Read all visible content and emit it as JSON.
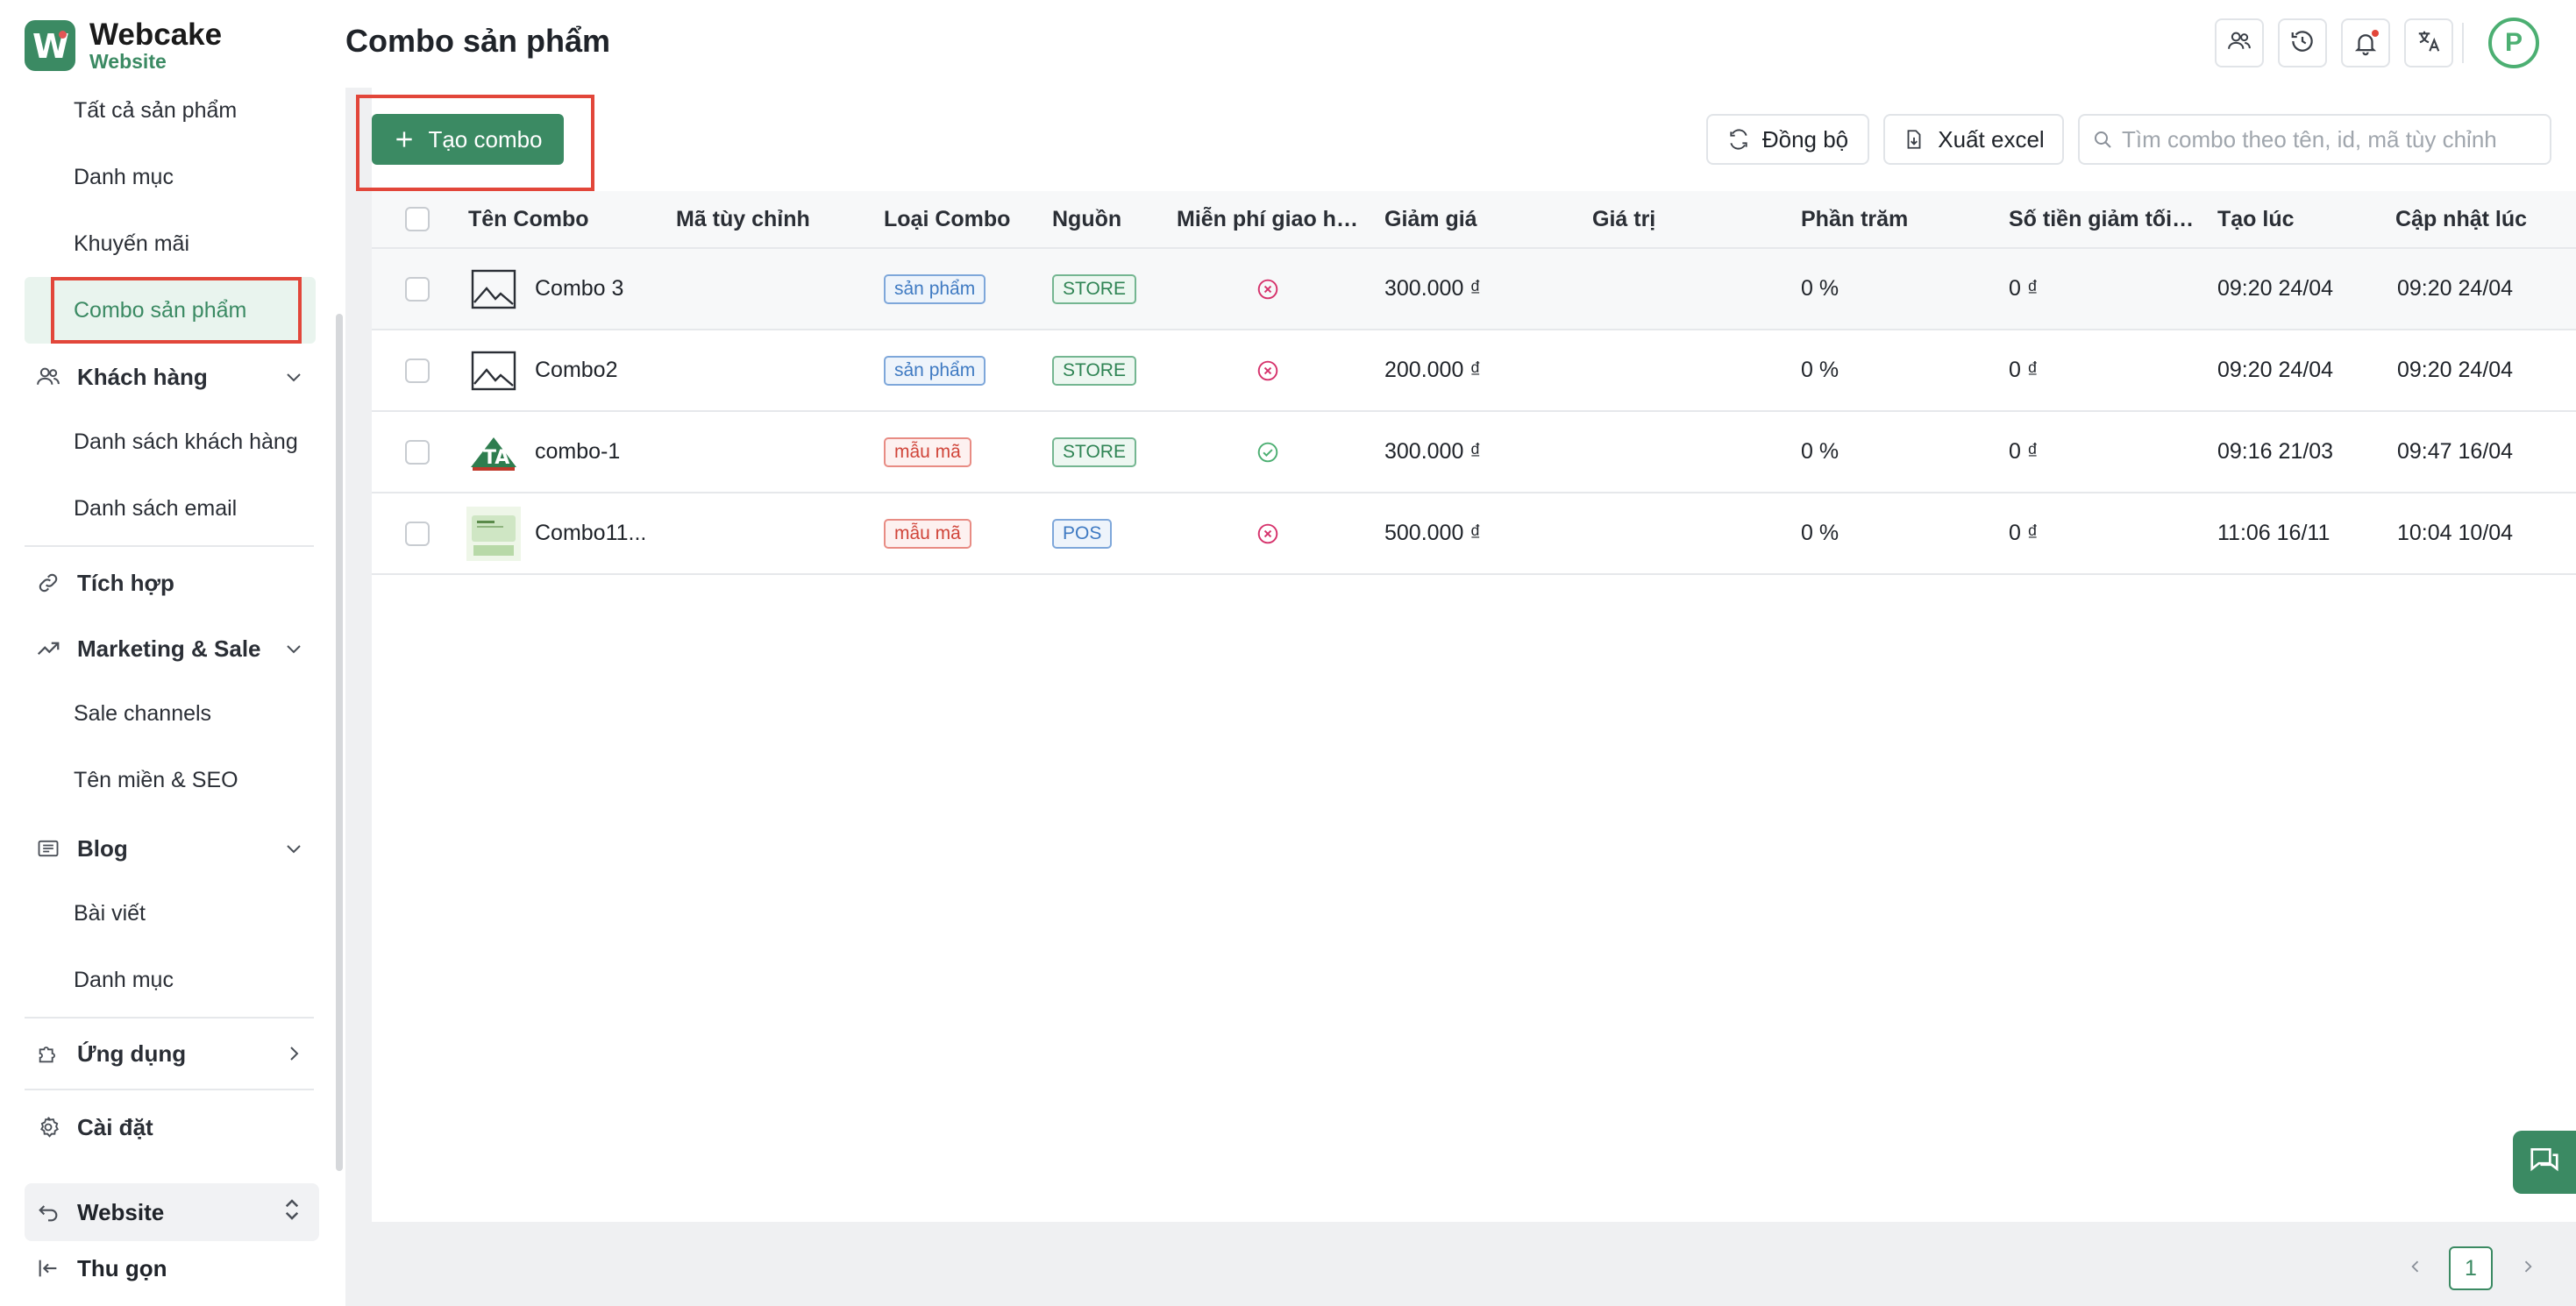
{
  "app": {
    "logo_name": "Webcake",
    "logo_sub": "Website",
    "logo_letter": "W"
  },
  "sidebar": {
    "product_items": [
      "Tất cả sản phẩm",
      "Danh mục",
      "Khuyến mãi"
    ],
    "active_item": "Combo sản phẩm",
    "customers": {
      "label": "Khách hàng",
      "items": [
        "Danh sách khách hàng",
        "Danh sách email"
      ]
    },
    "integration": "Tích hợp",
    "marketing": {
      "label": "Marketing & Sale",
      "items": [
        "Sale channels",
        "Tên miền & SEO"
      ]
    },
    "blog": {
      "label": "Blog",
      "items": [
        "Bài viết",
        "Danh mục"
      ]
    },
    "apps": "Ứng dụng",
    "settings": "Cài đặt",
    "site_switch": "Website",
    "collapse": "Thu gọn"
  },
  "header": {
    "title": "Combo sản phẩm",
    "avatar_letter": "P"
  },
  "toolbar": {
    "create_label": "Tạo combo",
    "sync_label": "Đồng bộ",
    "export_label": "Xuất excel",
    "search_placeholder": "Tìm combo theo tên, id, mã tùy chỉnh"
  },
  "table": {
    "columns": [
      "Tên Combo",
      "Mã tùy chỉnh",
      "Loại Combo",
      "Nguồn",
      "Miễn phí giao hà...",
      "Giảm giá",
      "Giá trị",
      "Phần trăm",
      "Số tiền giảm tối ...",
      "Tạo lúc",
      "Cập nhật lúc"
    ],
    "rows": [
      {
        "name": "Combo 3",
        "code": "",
        "type": "sản phẩm",
        "type_color": "blue",
        "source": "STORE",
        "free_ship": false,
        "discount": "300.000 ₫",
        "value": "",
        "percent": "0 %",
        "max_discount": "0 ₫",
        "created": "09:20 24/04",
        "updated": "09:20 24/04",
        "thumb": "image-placeholder-icon"
      },
      {
        "name": "Combo2",
        "code": "",
        "type": "sản phẩm",
        "type_color": "blue",
        "source": "STORE",
        "free_ship": false,
        "discount": "200.000 ₫",
        "value": "",
        "percent": "0 %",
        "max_discount": "0 ₫",
        "created": "09:20 24/04",
        "updated": "09:20 24/04",
        "thumb": "image-placeholder-icon"
      },
      {
        "name": "combo-1",
        "code": "",
        "type": "mẫu mã",
        "type_color": "red",
        "source": "STORE",
        "free_ship": true,
        "discount": "300.000 ₫",
        "value": "",
        "percent": "0 %",
        "max_discount": "0 ₫",
        "created": "09:16 21/03",
        "updated": "09:47 16/04",
        "thumb": "ta-logo-thumbnail"
      },
      {
        "name": "Combo11...",
        "code": "",
        "type": "mẫu mã",
        "type_color": "red",
        "source": "POS",
        "free_ship": false,
        "discount": "500.000 ₫",
        "value": "",
        "percent": "0 %",
        "max_discount": "0 ₫",
        "created": "11:06 16/11",
        "updated": "10:04 10/04",
        "thumb": "product-photo-thumbnail"
      }
    ]
  },
  "pagination": {
    "current": "1"
  },
  "colors": {
    "brand": "#3b8a63",
    "highlight": "#e2463a",
    "free_ship_yes": "#4caf72",
    "free_ship_no": "#d6336c"
  }
}
